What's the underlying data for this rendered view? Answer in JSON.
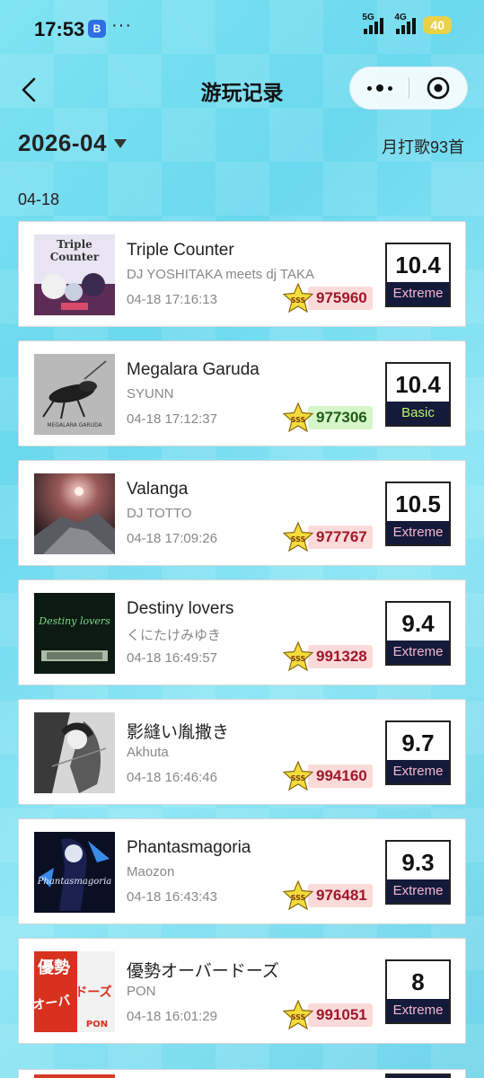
{
  "status_bar": {
    "time": "17:53",
    "app_badge": "B",
    "more": "···",
    "net1": "5G",
    "net2": "4G",
    "battery": "40"
  },
  "header": {
    "title": "游玩记录"
  },
  "month": {
    "value": "2026-04",
    "count_text": "月打歌93首"
  },
  "date_group": "04-18",
  "records": [
    {
      "title": "Triple Counter",
      "artist": "DJ YOSHITAKA meets dj TAKA",
      "time": "04-18 17:16:13",
      "score": "975960",
      "score_color": "pink",
      "diff": "10.4",
      "level": "Extreme",
      "cover_text": "Triple Counter"
    },
    {
      "title": "Megalara Garuda",
      "artist": "SYUNN",
      "time": "04-18 17:12:37",
      "score": "977306",
      "score_color": "green",
      "diff": "10.4",
      "level": "Basic",
      "cover_text": "Megalara Garuda"
    },
    {
      "title": "Valanga",
      "artist": "DJ TOTTO",
      "time": "04-18 17:09:26",
      "score": "977767",
      "score_color": "pink",
      "diff": "10.5",
      "level": "Extreme",
      "cover_text": ""
    },
    {
      "title": "Destiny lovers",
      "artist": "くにたけみゆき",
      "time": "04-18 16:49:57",
      "score": "991328",
      "score_color": "pink",
      "diff": "9.4",
      "level": "Extreme",
      "cover_text": "Destiny lovers"
    },
    {
      "title": "影縫い胤撒き",
      "artist": "Akhuta",
      "time": "04-18 16:46:46",
      "score": "994160",
      "score_color": "pink",
      "diff": "9.7",
      "level": "Extreme",
      "cover_text": ""
    },
    {
      "title": "Phantasmagoria",
      "artist": "Maozon",
      "time": "04-18 16:43:43",
      "score": "976481",
      "score_color": "pink",
      "diff": "9.3",
      "level": "Extreme",
      "cover_text": "Phantasmagoria"
    },
    {
      "title": "優勢オーバードーズ",
      "artist": "PON",
      "time": "04-18 16:01:29",
      "score": "991051",
      "score_color": "pink",
      "diff": "8",
      "level": "Extreme",
      "cover_text": "優勢 オーバードーズ PON"
    }
  ],
  "rank_badge": "SSS",
  "colors": {
    "background": "#7fe3f2",
    "score_pink_bg": "#fbdada",
    "score_pink_text": "#a0182a",
    "score_green_bg": "#d5f6c8",
    "level_bg": "#141a3a",
    "extreme_text": "#f4b6d0",
    "basic_text": "#b8f56c"
  }
}
